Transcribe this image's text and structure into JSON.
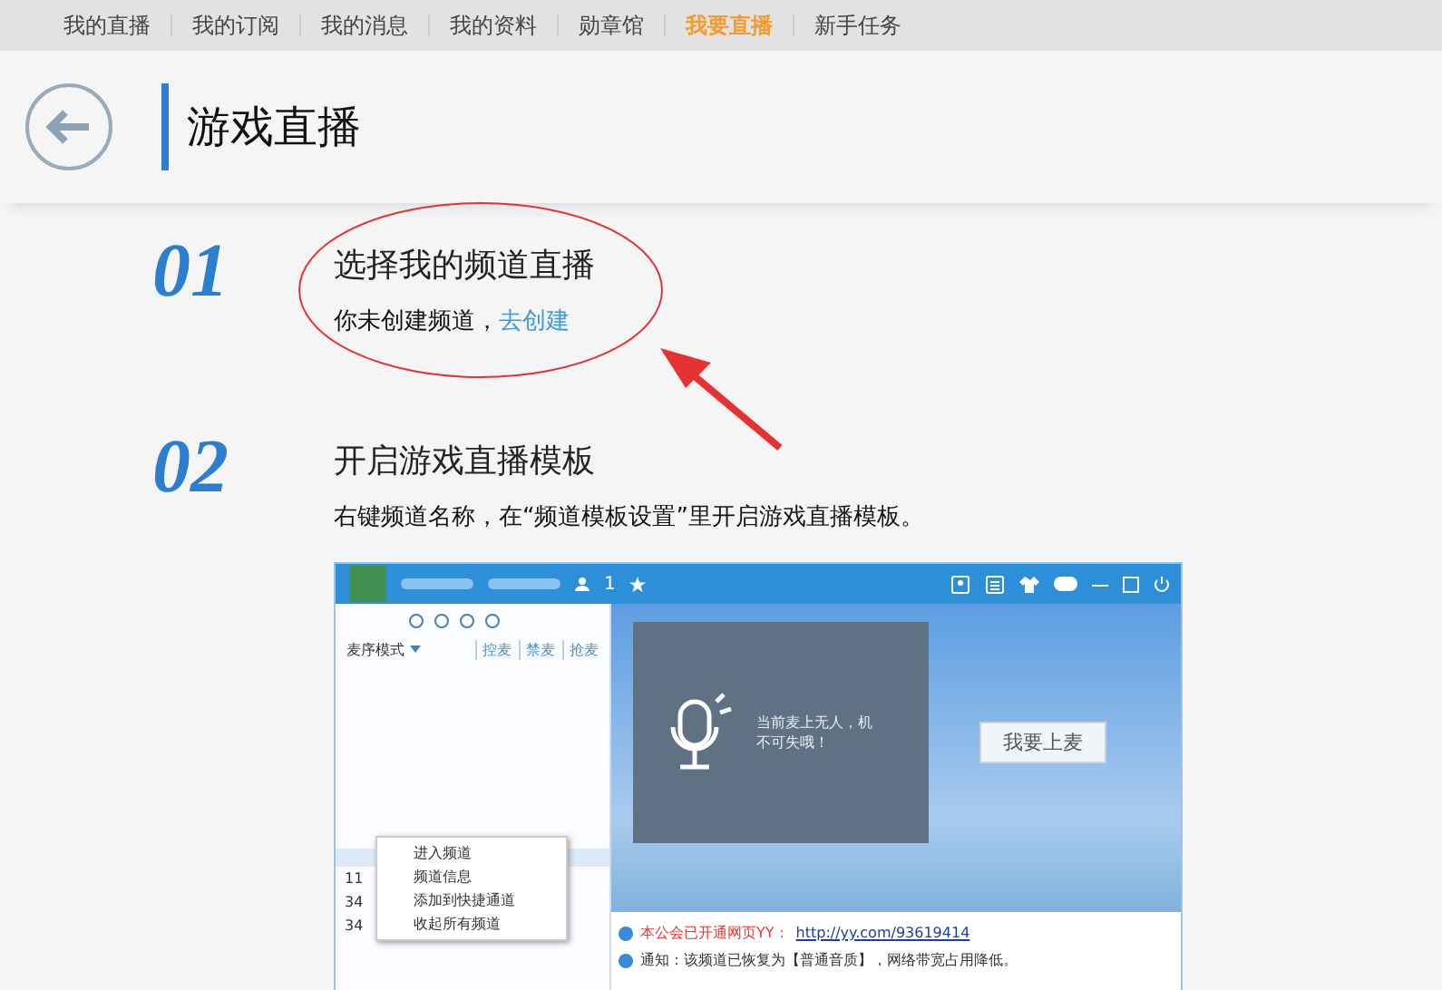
{
  "nav": [
    {
      "label": "我的直播",
      "selected": false
    },
    {
      "label": "我的订阅",
      "selected": false
    },
    {
      "label": "我的消息",
      "selected": false
    },
    {
      "label": "我的资料",
      "selected": false
    },
    {
      "label": "勋章馆",
      "selected": false
    },
    {
      "label": "我要直播",
      "selected": true
    },
    {
      "label": "新手任务",
      "selected": false
    }
  ],
  "header": {
    "title": "游戏直播"
  },
  "steps": [
    {
      "number": "01",
      "title": "选择我的频道直播",
      "text": "你未创建频道，",
      "link": "去创建"
    },
    {
      "number": "02",
      "title": "开启游戏直播模板",
      "text": "右键频道名称，在“频道模板设置”里开启游戏直播模板。"
    }
  ],
  "client": {
    "online_count": "1",
    "mic_mode": "麦序模式",
    "mic_actions": [
      "控麦",
      "禁麦",
      "抢麦"
    ],
    "tree_rows": [
      "11",
      "34",
      "34"
    ],
    "context_menu": [
      "进入频道",
      "频道信息",
      "添加到快捷通道",
      "收起所有频道"
    ],
    "stage_text": "当前麦上无人，机不可失哦！",
    "mic_button": "我要上麦",
    "messages": [
      {
        "kind": "link",
        "label": "本公会已开通网页YY：",
        "url": "http://yy.com/93619414"
      },
      {
        "kind": "notice",
        "label": "通知：该频道已恢复为【普通音质】，网络带宽占用降低。"
      }
    ]
  }
}
